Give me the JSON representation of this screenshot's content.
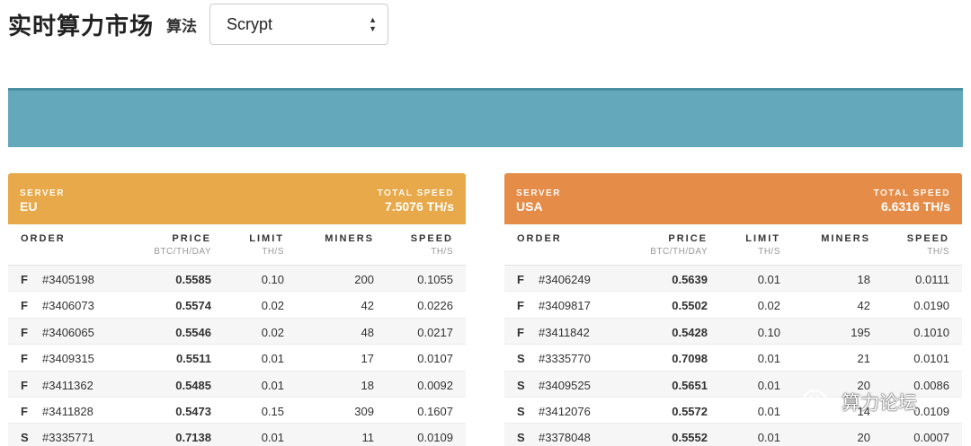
{
  "header": {
    "title": "实时算力市场",
    "algo_label": "算法",
    "algo_selected": "Scrypt"
  },
  "columns": {
    "order": "ORDER",
    "price": "PRICE",
    "price_unit": "BTC/TH/DAY",
    "limit": "LIMIT",
    "limit_unit": "TH/S",
    "miners": "MINERS",
    "speed": "SPEED",
    "speed_unit": "TH/S"
  },
  "panels": {
    "eu": {
      "server_caption": "SERVER",
      "server": "EU",
      "total_caption": "TOTAL SPEED",
      "total_speed": "7.5076 TH/s",
      "color": "#e7a94a",
      "rows": [
        {
          "type": "F",
          "id": "#3405198",
          "price": "0.5585",
          "limit": "0.10",
          "miners": "200",
          "speed": "0.1055"
        },
        {
          "type": "F",
          "id": "#3406073",
          "price": "0.5574",
          "limit": "0.02",
          "miners": "42",
          "speed": "0.0226"
        },
        {
          "type": "F",
          "id": "#3406065",
          "price": "0.5546",
          "limit": "0.02",
          "miners": "48",
          "speed": "0.0217"
        },
        {
          "type": "F",
          "id": "#3409315",
          "price": "0.5511",
          "limit": "0.01",
          "miners": "17",
          "speed": "0.0107"
        },
        {
          "type": "F",
          "id": "#3411362",
          "price": "0.5485",
          "limit": "0.01",
          "miners": "18",
          "speed": "0.0092"
        },
        {
          "type": "F",
          "id": "#3411828",
          "price": "0.5473",
          "limit": "0.15",
          "miners": "309",
          "speed": "0.1607"
        },
        {
          "type": "S",
          "id": "#3335771",
          "price": "0.7138",
          "limit": "0.01",
          "miners": "11",
          "speed": "0.0109"
        }
      ]
    },
    "usa": {
      "server_caption": "SERVER",
      "server": "USA",
      "total_caption": "TOTAL SPEED",
      "total_speed": "6.6316 TH/s",
      "color": "#e58c48",
      "rows": [
        {
          "type": "F",
          "id": "#3406249",
          "price": "0.5639",
          "limit": "0.01",
          "miners": "18",
          "speed": "0.0111"
        },
        {
          "type": "F",
          "id": "#3409817",
          "price": "0.5502",
          "limit": "0.02",
          "miners": "42",
          "speed": "0.0190"
        },
        {
          "type": "F",
          "id": "#3411842",
          "price": "0.5428",
          "limit": "0.10",
          "miners": "195",
          "speed": "0.1010"
        },
        {
          "type": "S",
          "id": "#3335770",
          "price": "0.7098",
          "limit": "0.01",
          "miners": "21",
          "speed": "0.0101"
        },
        {
          "type": "S",
          "id": "#3409525",
          "price": "0.5651",
          "limit": "0.01",
          "miners": "20",
          "speed": "0.0086"
        },
        {
          "type": "S",
          "id": "#3412076",
          "price": "0.5572",
          "limit": "0.01",
          "miners": "14",
          "speed": "0.0109"
        },
        {
          "type": "S",
          "id": "#3378048",
          "price": "0.5552",
          "limit": "0.01",
          "miners": "20",
          "speed": "0.0007"
        }
      ]
    }
  },
  "banner": {
    "color": "#64a8bb"
  },
  "watermark": {
    "text": "算力论坛",
    "icon": "wechat-icon"
  }
}
